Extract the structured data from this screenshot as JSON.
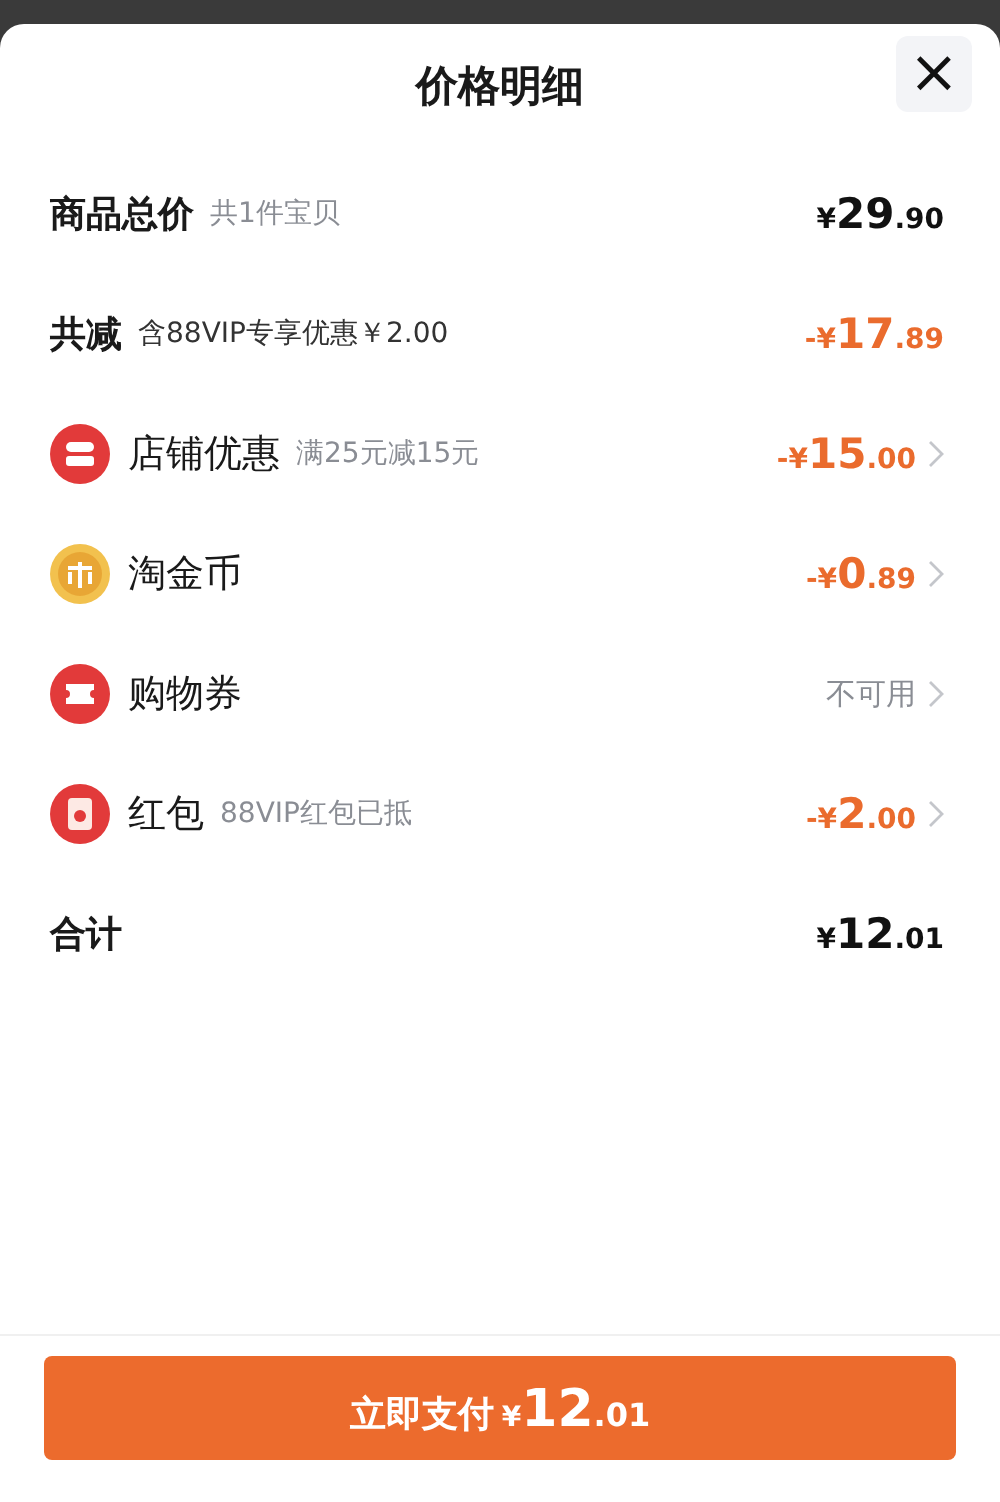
{
  "sheet": {
    "title": "价格明细",
    "close_icon": "×"
  },
  "rows": [
    {
      "kind": "summary",
      "label": "商品总价",
      "note": "共1件宝贝",
      "amount": {
        "color": "#111111",
        "prefix": "¥",
        "whole": "29",
        "cents": ".90"
      },
      "chevron": false
    },
    {
      "kind": "summary",
      "label": "共减",
      "note": "含88VIP专享优惠￥2.00",
      "amount": {
        "color": "#ea6b2d",
        "prefix": "-¥",
        "whole": "17",
        "cents": ".89"
      },
      "chevron": false
    },
    {
      "kind": "shop",
      "label": "店铺优惠",
      "note": "满25元减15元",
      "amount": {
        "color": "#ea6b2d",
        "prefix": "-¥",
        "whole": "15",
        "cents": ".00"
      },
      "chevron": true
    },
    {
      "kind": "coin",
      "label": "淘金币",
      "amount": {
        "color": "#ea6b2d",
        "prefix": "-¥",
        "whole": "0",
        "cents": ".89"
      },
      "chevron": true
    },
    {
      "kind": "ticket",
      "label": "购物券",
      "status": "不可用",
      "chevron": true
    },
    {
      "kind": "envelope",
      "label": "红包",
      "note": "88VIP红包已抵",
      "amount": {
        "color": "#ea6b2d",
        "prefix": "-¥",
        "whole": "2",
        "cents": ".00"
      },
      "chevron": true
    },
    {
      "kind": "summary",
      "label": "合计",
      "amount": {
        "color": "#111111",
        "prefix": "¥",
        "whole": "12",
        "cents": ".01"
      },
      "chevron": false
    }
  ],
  "pay_button": {
    "label": "立即支付",
    "prefix": "¥",
    "whole": "12",
    "cents": ".01"
  }
}
